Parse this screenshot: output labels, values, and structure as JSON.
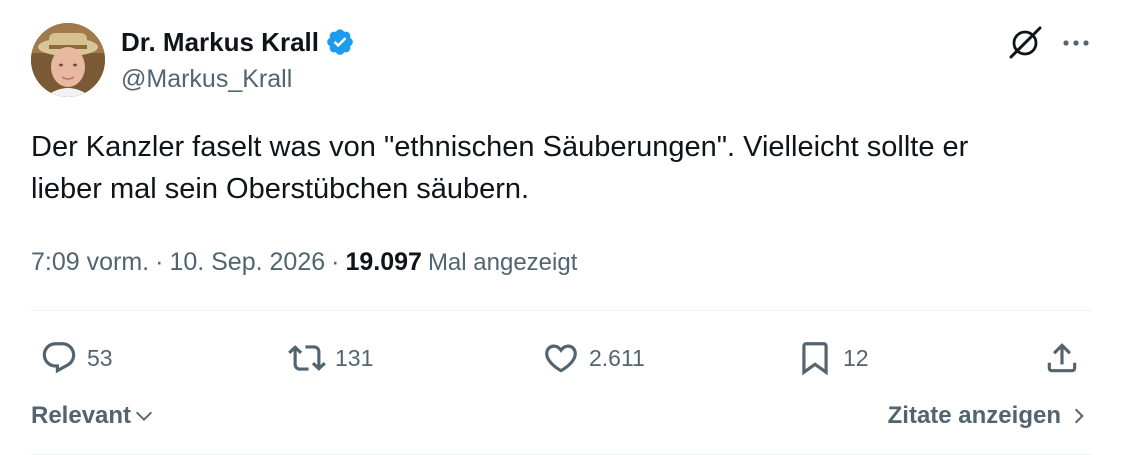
{
  "author": {
    "name": "Dr. Markus Krall",
    "handle": "@Markus_Krall",
    "verified": true
  },
  "tweet": {
    "text": "Der Kanzler faselt was von \"ethnischen Säuberungen\". Vielleicht sollte er\nlieber mal sein Oberstübchen säubern.",
    "time": "7:09 vorm.",
    "separator": "·",
    "date": "10. Sep. 2026",
    "views_count": "19.097",
    "views_label": "Mal angezeigt"
  },
  "actions": {
    "replies": "53",
    "retweets": "131",
    "likes": "2.611",
    "bookmarks": "12"
  },
  "footer": {
    "sort_label": "Relevant",
    "quotes_label": "Zitate anzeigen"
  },
  "icons": {
    "verified": "verified-badge-icon",
    "grok": "grok-icon",
    "more": "more-icon",
    "reply": "reply-icon",
    "retweet": "retweet-icon",
    "like": "heart-icon",
    "bookmark": "bookmark-icon",
    "share": "share-icon"
  },
  "colors": {
    "text": "#0f1419",
    "secondary": "#536471",
    "verified_blue": "#1d9bf0",
    "divider": "#eff3f4"
  }
}
